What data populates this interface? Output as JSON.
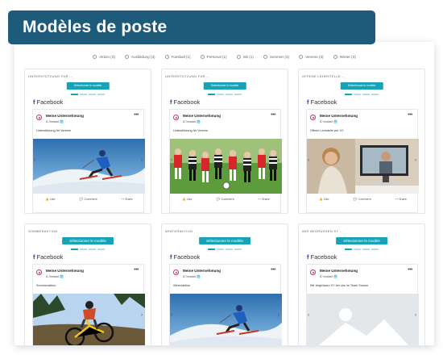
{
  "title": "Modèles de poste",
  "filters": [
    {
      "label": "Aktion (3)"
    },
    {
      "label": "Ausbildung (3)"
    },
    {
      "label": "Fussball (1)"
    },
    {
      "label": "Personal (1)"
    },
    {
      "label": "Ski (1)"
    },
    {
      "label": "Sommer (3)"
    },
    {
      "label": "Vereine (3)"
    },
    {
      "label": "Winter (3)"
    }
  ],
  "select_label": "Sélectionner le modèle",
  "network": "Facebook",
  "account": "Meine Unternehmung",
  "time": "À l'instant",
  "actions": {
    "like": "Like",
    "comment": "Comment",
    "share": "Share"
  },
  "cards": [
    {
      "category": "UNTERSTÜTZUNG FÜR ...",
      "caption": "Unterstützung für Vereine",
      "image": "skier-icon"
    },
    {
      "category": "UNTERSTÜTZUNG FÜR ...",
      "caption": "Unterstützung für Vereine",
      "image": "football-team-icon"
    },
    {
      "category": "OFFENE LEHRSTELLE ...",
      "caption": "Offene Lehrstelle per XY",
      "image": "video-call-icon"
    },
    {
      "category": "SOMMERAKTION",
      "caption": "Sommeraktion",
      "image": "mountain-biker-icon"
    },
    {
      "category": "WINTERAKTION",
      "caption": "Winteraktion",
      "image": "skier-icon"
    },
    {
      "category": "WIR BEGRÜSSEN XY ...",
      "caption": "Wir begrüssen XY bei uns im Team Sursee",
      "image": "image-placeholder-icon"
    }
  ],
  "colors": {
    "banner": "#1e5b7b",
    "accent": "#17a2b8"
  }
}
